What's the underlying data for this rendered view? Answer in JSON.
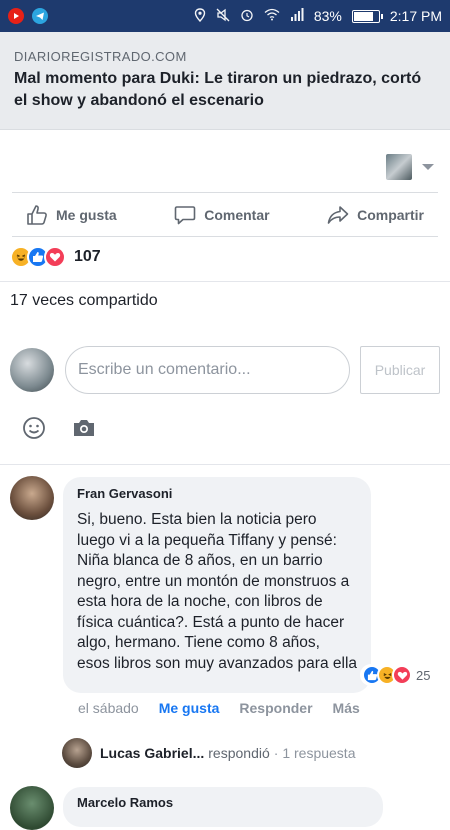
{
  "status_bar": {
    "battery": "83%",
    "battery_level": 0.83,
    "time": "2:17 PM"
  },
  "link_preview": {
    "domain": "DIARIOREGISTRADO.COM",
    "title": "Mal momento para Duki: Le tiraron un piedrazo, cortó el show y abandonó el escenario"
  },
  "actions": {
    "like": "Me gusta",
    "comment": "Comentar",
    "share": "Compartir"
  },
  "reactions": {
    "count": "107"
  },
  "shares_text": "17 veces compartido",
  "composer": {
    "placeholder": "Escribe un comentario...",
    "publish": "Publicar"
  },
  "comments": [
    {
      "author": "Fran Gervasoni",
      "text": "Si, bueno. Esta bien la noticia pero luego vi a la pequeña Tiffany y pensé: Niña blanca de 8 años, en un barrio negro, entre un montón de monstruos a esta hora de la noche, con libros de física cuántica?. Está a punto de hacer algo, hermano. Tiene como 8 años, esos libros son muy avanzados para ella",
      "reaction_count": "25",
      "time": "el sábado",
      "like": "Me gusta",
      "reply": "Responder",
      "more": "Más",
      "reply_preview": {
        "name": "Lucas Gabriel...",
        "action": "respondió",
        "count": "· 1 respuesta"
      }
    },
    {
      "author": "Marcelo Ramos"
    }
  ],
  "colors": {
    "status_bar": "#1e3a6e",
    "accent": "#1877f2",
    "bubble": "#f0f2f5"
  }
}
